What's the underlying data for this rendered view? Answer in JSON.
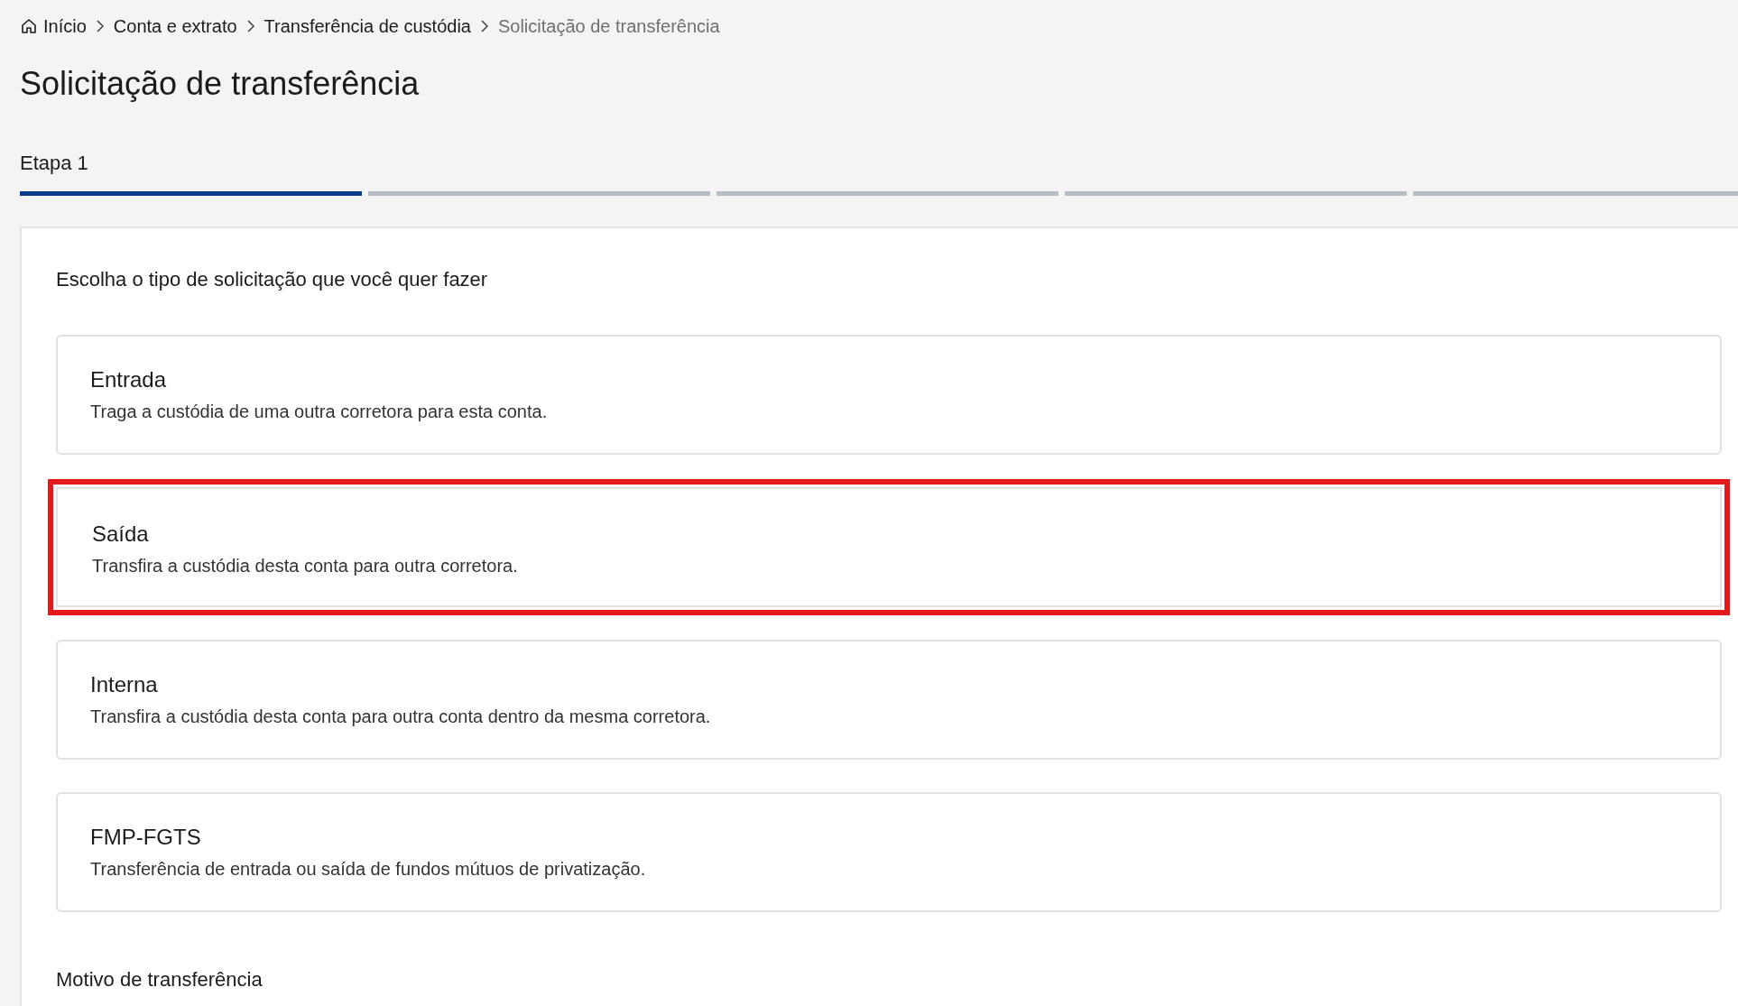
{
  "breadcrumb": [
    {
      "label": "Início",
      "kind": "home"
    },
    {
      "label": "Conta e extrato",
      "kind": "link"
    },
    {
      "label": "Transferência de custódia",
      "kind": "link"
    },
    {
      "label": "Solicitação de transferência",
      "kind": "current"
    }
  ],
  "title": "Solicitação de transferência",
  "stepper": {
    "label": "Etapa 1",
    "steps": [
      {
        "active": true
      },
      {
        "active": false
      },
      {
        "active": false
      },
      {
        "active": false
      },
      {
        "active": false
      }
    ]
  },
  "form": {
    "question": "Escolha o tipo de solicitação que você quer fazer",
    "options": [
      {
        "title": "Entrada",
        "description": "Traga a custódia de uma outra corretora para esta conta.",
        "highlighted": false
      },
      {
        "title": "Saída",
        "description": "Transfira a custódia desta conta para outra corretora.",
        "highlighted": true
      },
      {
        "title": "Interna",
        "description": "Transfira a custódia desta conta para outra conta dentro da mesma corretora.",
        "highlighted": false
      },
      {
        "title": "FMP-FGTS",
        "description": "Transferência de entrada ou saída de fundos mútuos de privatização.",
        "highlighted": false
      }
    ],
    "next_section": "Motivo de transferência"
  }
}
